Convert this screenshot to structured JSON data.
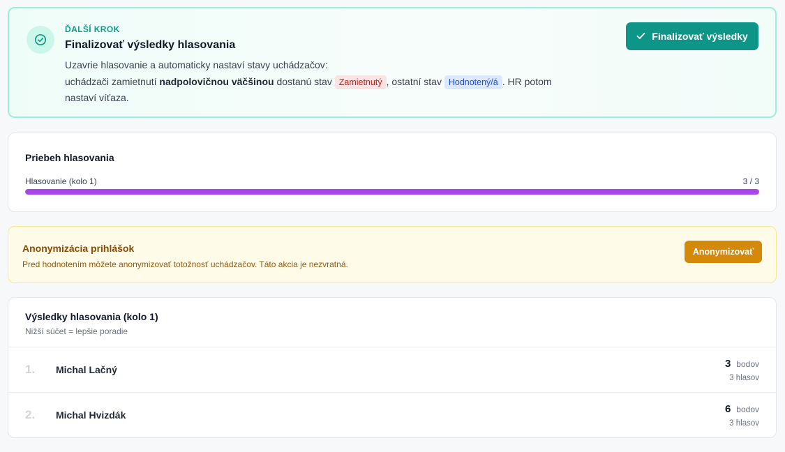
{
  "next_step": {
    "eyebrow": "ĎALŠÍ KROK",
    "title": "Finalizovať výsledky hlasovania",
    "desc_line1": "Uzavrie hlasovanie a automaticky nastaví stavy uchádzačov:",
    "desc_pre": "uchádzači zamietnutí",
    "desc_bold": "nadpolovičnou väčšinou",
    "desc_mid": "dostanú stav",
    "badge_rejected": "Zamietnutý",
    "desc_mid2": ", ostatní stav",
    "badge_rated": "Hodnotený/á",
    "desc_end": ". HR potom nastaví víťaza.",
    "button_label": "Finalizovať výsledky",
    "icon": "check-circle-icon",
    "accent_color": "#0f9588"
  },
  "progress": {
    "title": "Priebeh hlasovania",
    "label": "Hlasovanie (kolo 1)",
    "count": "3 / 3",
    "fraction": 1.0,
    "bar_color": "#a745ef"
  },
  "anonymization": {
    "title": "Anonymizácia prihlášok",
    "description": "Pred hodnotením môžete anonymizovať totožnosť uchádzačov. Táto akcia je nezvratná.",
    "button_label": "Anonymizovať"
  },
  "results": {
    "title": "Výsledky hlasovania (kolo 1)",
    "subtitle": "Nižší súčet = lepšie poradie",
    "rows": [
      {
        "rank": "1.",
        "name": "Michal Lačný",
        "points": "3",
        "points_unit": "bodov",
        "votes": "3 hlasov"
      },
      {
        "rank": "2.",
        "name": "Michal Hvizdák",
        "points": "6",
        "points_unit": "bodov",
        "votes": "3 hlasov"
      }
    ]
  }
}
